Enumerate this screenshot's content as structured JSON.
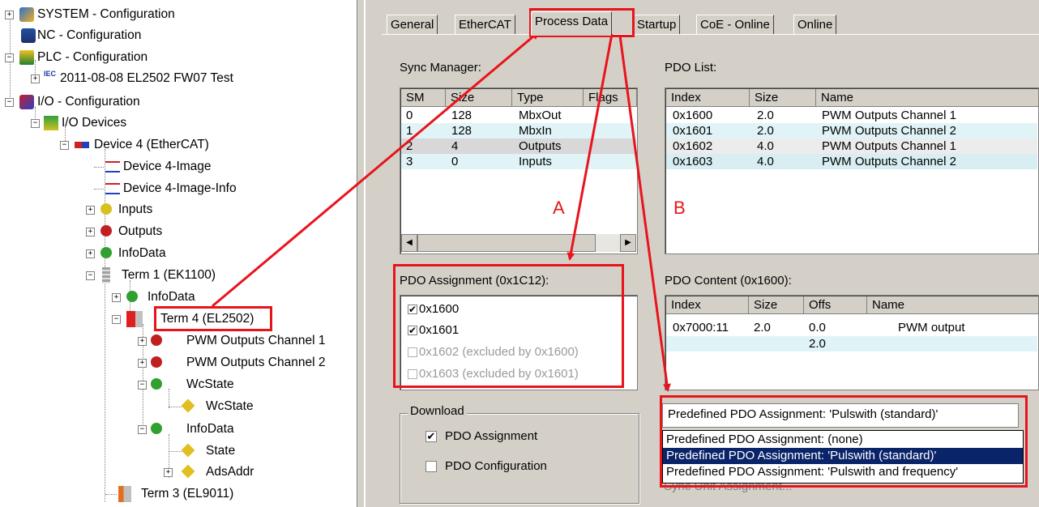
{
  "tree": {
    "items": [
      {
        "label": "SYSTEM - Configuration"
      },
      {
        "label": "NC - Configuration"
      },
      {
        "label": "PLC - Configuration"
      },
      {
        "label": "2011-08-08 EL2502 FW07 Test"
      },
      {
        "label": "I/O - Configuration"
      },
      {
        "label": "I/O Devices"
      },
      {
        "label": "Device 4 (EtherCAT)"
      },
      {
        "label": "Device 4-Image"
      },
      {
        "label": "Device 4-Image-Info"
      },
      {
        "label": "Inputs"
      },
      {
        "label": "Outputs"
      },
      {
        "label": "InfoData"
      },
      {
        "label": "Term 1 (EK1100)"
      },
      {
        "label": "InfoData"
      },
      {
        "label": "Term 4 (EL2502)"
      },
      {
        "label": "PWM Outputs Channel 1"
      },
      {
        "label": "PWM Outputs Channel 2"
      },
      {
        "label": "WcState"
      },
      {
        "label": "WcState"
      },
      {
        "label": "InfoData"
      },
      {
        "label": "State"
      },
      {
        "label": "AdsAddr"
      },
      {
        "label": "Term 3 (EL9011)"
      }
    ],
    "iec_label": "IEC"
  },
  "tabs": [
    "General",
    "EtherCAT",
    "Process Data",
    "Startup",
    "CoE - Online",
    "Online"
  ],
  "sync_manager": {
    "title": "Sync Manager:",
    "columns": [
      "SM",
      "Size",
      "Type",
      "Flags"
    ],
    "rows": [
      {
        "sm": "0",
        "size": "128",
        "type": "MbxOut",
        "flags": ""
      },
      {
        "sm": "1",
        "size": "128",
        "type": "MbxIn",
        "flags": ""
      },
      {
        "sm": "2",
        "size": "4",
        "type": "Outputs",
        "flags": ""
      },
      {
        "sm": "3",
        "size": "0",
        "type": "Inputs",
        "flags": ""
      }
    ]
  },
  "pdo_list": {
    "title": "PDO List:",
    "columns": [
      "Index",
      "Size",
      "Name"
    ],
    "rows": [
      {
        "index": "0x1600",
        "size": "2.0",
        "name": "PWM Outputs Channel 1"
      },
      {
        "index": "0x1601",
        "size": "2.0",
        "name": "PWM Outputs Channel 2"
      },
      {
        "index": "0x1602",
        "size": "4.0",
        "name": "PWM Outputs Channel 1"
      },
      {
        "index": "0x1603",
        "size": "4.0",
        "name": "PWM Outputs Channel 2"
      }
    ]
  },
  "pdo_assignment": {
    "title": "PDO Assignment (0x1C12):",
    "items": [
      {
        "label": "0x1600",
        "checked": true,
        "enabled": true
      },
      {
        "label": "0x1601",
        "checked": true,
        "enabled": true
      },
      {
        "label": "0x1602 (excluded by 0x1600)",
        "checked": false,
        "enabled": false
      },
      {
        "label": "0x1603 (excluded by 0x1601)",
        "checked": false,
        "enabled": false
      }
    ]
  },
  "pdo_content": {
    "title": "PDO Content (0x1600):",
    "columns": [
      "Index",
      "Size",
      "Offs",
      "Name"
    ],
    "rows": [
      {
        "index": "0x7000:11",
        "size": "2.0",
        "offs": "0.0",
        "name": "PWM output"
      },
      {
        "index": "",
        "size": "",
        "offs": "2.0",
        "name": ""
      }
    ]
  },
  "download": {
    "title": "Download",
    "pdo_assignment": {
      "label": "PDO Assignment",
      "checked": true
    },
    "pdo_configuration": {
      "label": "PDO Configuration",
      "checked": false
    }
  },
  "predefined": {
    "selected": "Predefined PDO Assignment: 'Pulswith (standard)'",
    "options": [
      "Predefined PDO Assignment: (none)",
      "Predefined PDO Assignment: 'Pulswith (standard)'",
      "Predefined PDO Assignment: 'Pulswith and frequency'"
    ],
    "highlighted_index": 1,
    "hidden_button_label": "Sync Unit Assignment..."
  },
  "annotations": {
    "a": "A",
    "b": "B"
  },
  "colors": {
    "highlight_red": "#e8141c",
    "selection": "#0a246a",
    "row_alt": "#e0f4f8",
    "panel": "#d4d0c8"
  }
}
